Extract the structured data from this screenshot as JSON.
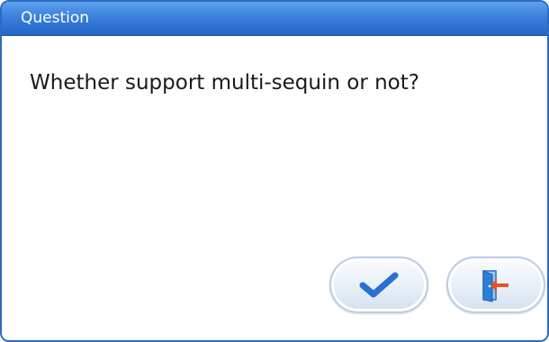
{
  "dialog": {
    "title": "Question",
    "message": "Whether support multi-sequin or not?"
  },
  "buttons": {
    "ok_icon": "checkmark-icon",
    "exit_icon": "exit-door-icon"
  },
  "colors": {
    "titlebar": "#3a80dc",
    "border": "#2b6bc4",
    "checkmark": "#2a6fd2",
    "door": "#2a7fd8",
    "arrow": "#e8531f"
  }
}
